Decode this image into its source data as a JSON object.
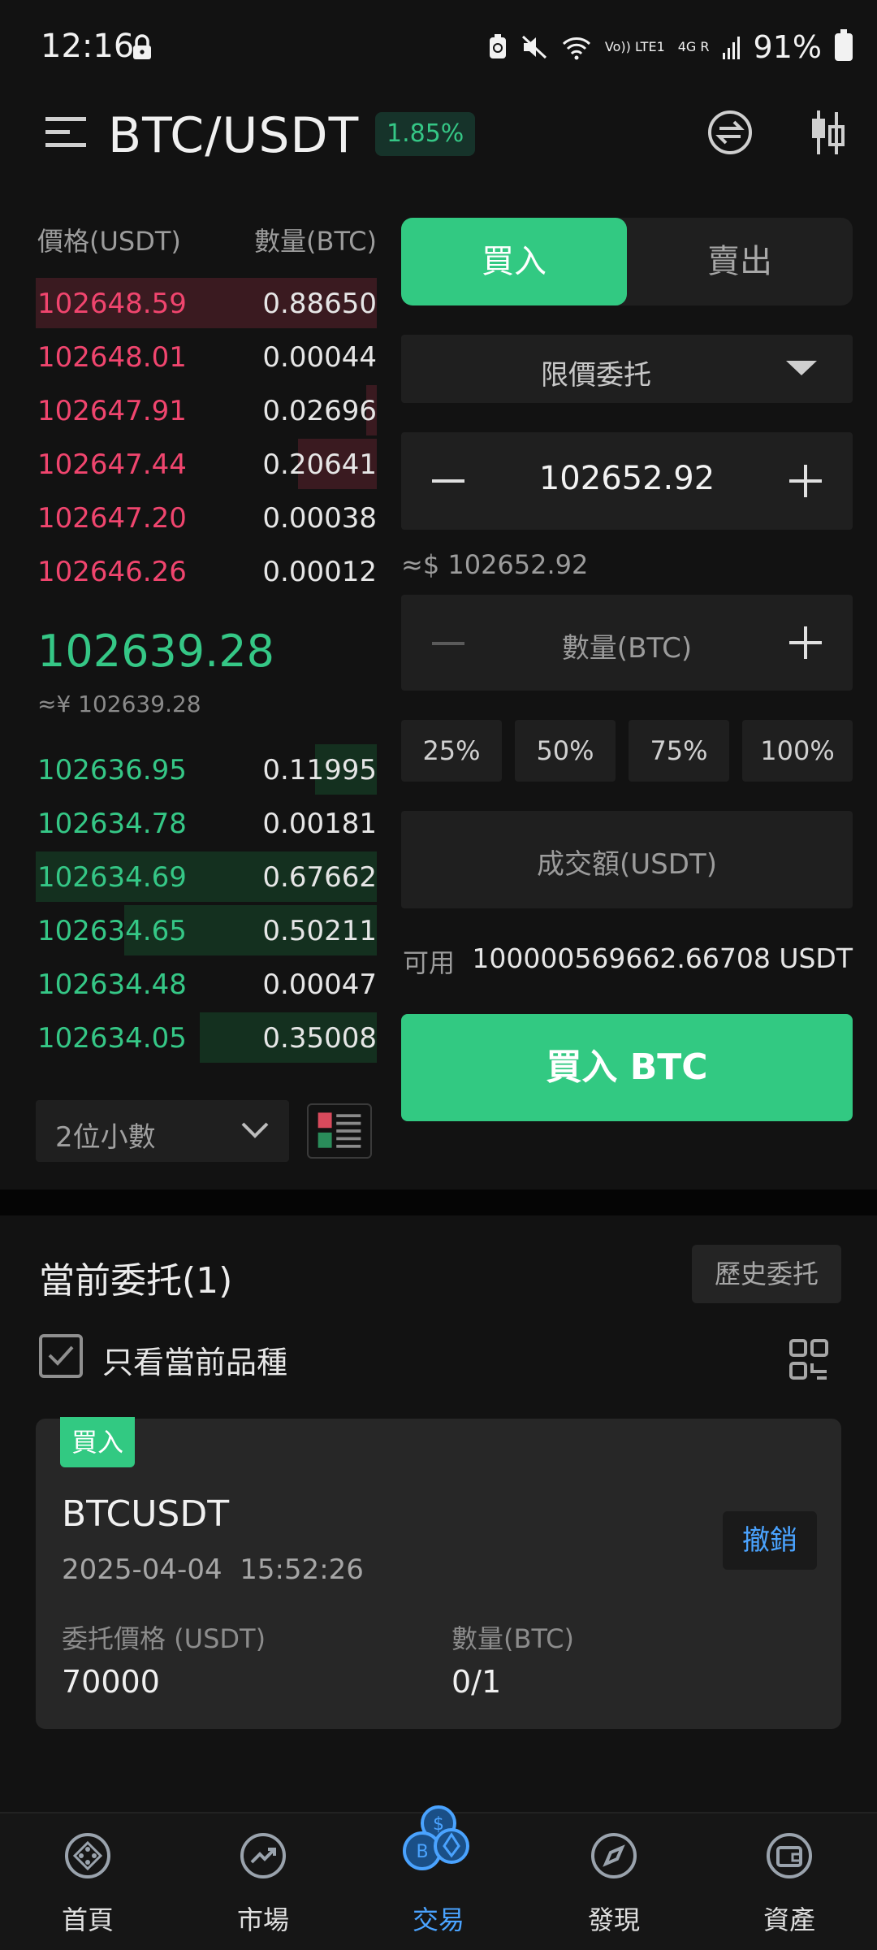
{
  "status_bar": {
    "time": "12:16",
    "signal_text": "Vo)) LTE1",
    "net_text": "4G R",
    "battery": "91%"
  },
  "header": {
    "pair": "BTC/USDT",
    "change": "1.85%"
  },
  "order_book": {
    "price_header": "價格(USDT)",
    "qty_header": "數量(BTC)",
    "asks": [
      {
        "price": "102648.59",
        "qty": "0.88650",
        "depth": 1.0
      },
      {
        "price": "102648.01",
        "qty": "0.00044",
        "depth": 0.0
      },
      {
        "price": "102647.91",
        "qty": "0.02696",
        "depth": 0.03
      },
      {
        "price": "102647.44",
        "qty": "0.20641",
        "depth": 0.23
      },
      {
        "price": "102647.20",
        "qty": "0.00038",
        "depth": 0.0
      },
      {
        "price": "102646.26",
        "qty": "0.00012",
        "depth": 0.0
      }
    ],
    "last_price": "102639.28",
    "last_price_approx": "≈¥ 102639.28",
    "bids": [
      {
        "price": "102636.95",
        "qty": "0.11995",
        "depth": 0.18
      },
      {
        "price": "102634.78",
        "qty": "0.00181",
        "depth": 0.0
      },
      {
        "price": "102634.69",
        "qty": "0.67662",
        "depth": 1.0
      },
      {
        "price": "102634.65",
        "qty": "0.50211",
        "depth": 0.74
      },
      {
        "price": "102634.48",
        "qty": "0.00047",
        "depth": 0.0
      },
      {
        "price": "102634.05",
        "qty": "0.35008",
        "depth": 0.52
      }
    ],
    "decimals": "2位小數"
  },
  "trade_panel": {
    "tab_buy": "買入",
    "tab_sell": "賣出",
    "order_type": "限價委托",
    "price_value": "102652.92",
    "price_approx": "≈$ 102652.92",
    "qty_placeholder": "數量(BTC)",
    "percents": [
      "25%",
      "50%",
      "75%",
      "100%"
    ],
    "total_placeholder": "成交額(USDT)",
    "available_label": "可用",
    "available_value": "100000569662.66708 USDT",
    "buy_button": "買入 BTC"
  },
  "orders": {
    "title": "當前委托(1)",
    "history_button": "歷史委托",
    "only_current_label": "只看當前品種",
    "only_current_checked": true,
    "card": {
      "side": "買入",
      "symbol": "BTCUSDT",
      "datetime": "2025-04-04  15:52:26",
      "cancel": "撤銷",
      "price_label": "委托價格 (USDT)",
      "price_value": "70000",
      "qty_label": "數量(BTC)",
      "qty_value": "0/1"
    }
  },
  "bottom_nav": [
    {
      "label": "首頁",
      "icon": "home-icon"
    },
    {
      "label": "市場",
      "icon": "market-icon"
    },
    {
      "label": "交易",
      "icon": "trade-icon",
      "active": true
    },
    {
      "label": "發現",
      "icon": "discover-icon"
    },
    {
      "label": "資產",
      "icon": "wallet-icon"
    }
  ],
  "colors": {
    "accent_green": "#32c982",
    "accent_red": "#f0456e",
    "link_blue": "#4aa3ff",
    "background": "#121212"
  }
}
